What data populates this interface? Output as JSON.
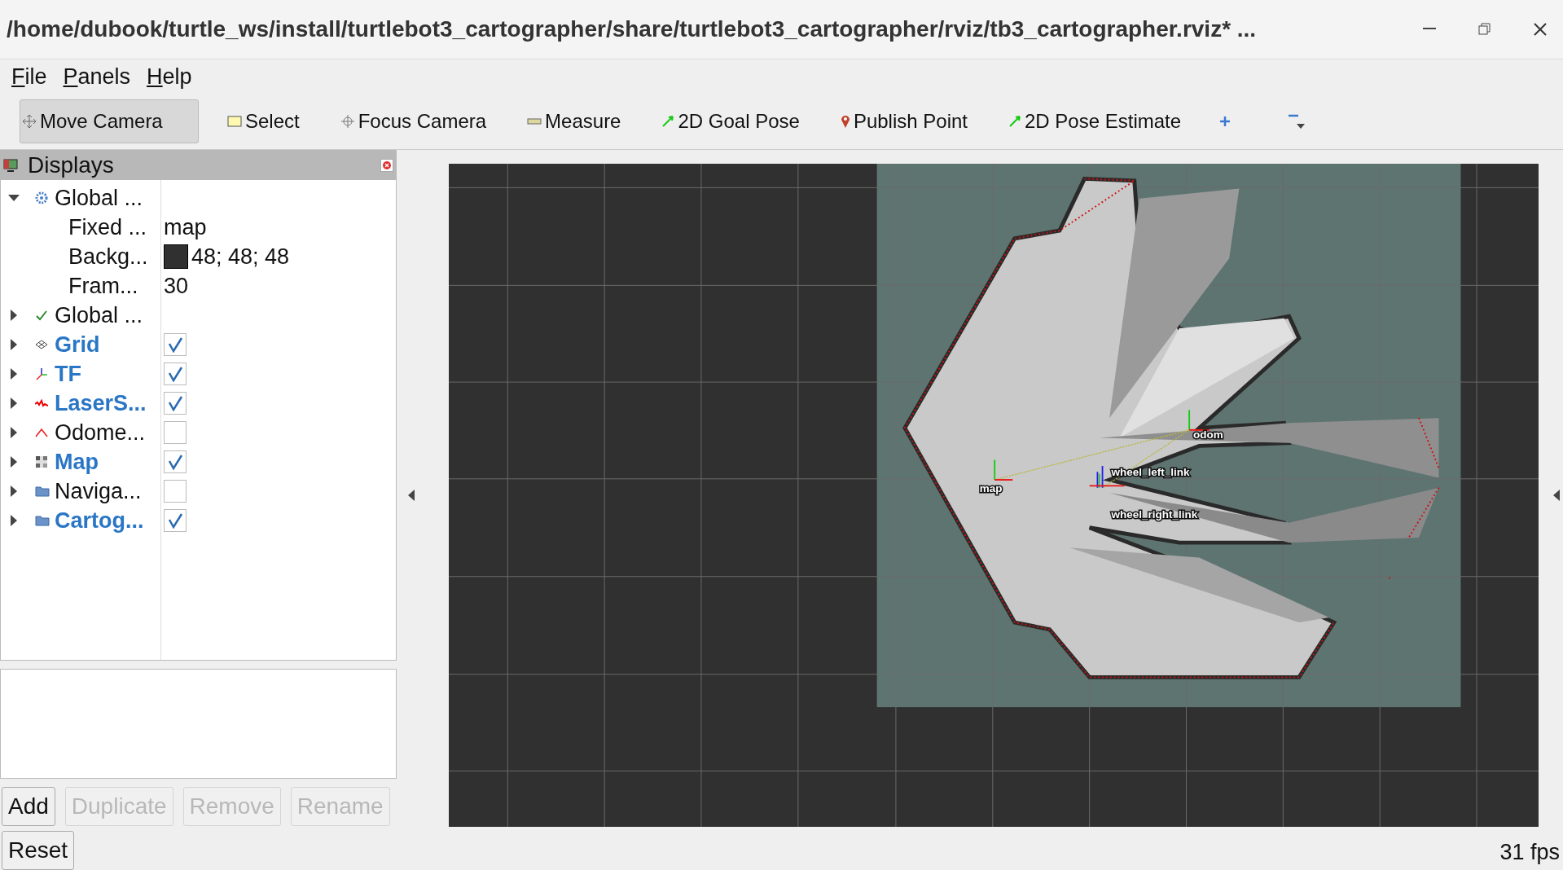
{
  "window": {
    "title": "/home/dubook/turtle_ws/install/turtlebot3_cartographer/share/turtlebot3_cartographer/rviz/tb3_cartographer.rviz* ..."
  },
  "menu": [
    "File",
    "Panels",
    "Help"
  ],
  "tools": [
    {
      "label": "Move Camera",
      "selected": true
    },
    {
      "label": "Select",
      "selected": false
    },
    {
      "label": "Focus Camera",
      "selected": false
    },
    {
      "label": "Measure",
      "selected": false
    },
    {
      "label": "2D Goal Pose",
      "selected": false
    },
    {
      "label": "Publish Point",
      "selected": false
    },
    {
      "label": "2D Pose Estimate",
      "selected": false
    }
  ],
  "displays": {
    "title": "Displays",
    "items": [
      {
        "kind": "global",
        "name": "Global ...",
        "expanded": true,
        "children": [
          {
            "name": "Fixed ...",
            "value": "map"
          },
          {
            "name": "Backg...",
            "value": "48; 48; 48",
            "color": "#303030"
          },
          {
            "name": "Fram...",
            "value": "30"
          }
        ]
      },
      {
        "kind": "global",
        "name": "Global ...",
        "expanded": false
      },
      {
        "kind": "display",
        "name": "Grid",
        "expanded": false,
        "checked": true
      },
      {
        "kind": "display",
        "name": "TF",
        "expanded": false,
        "checked": true
      },
      {
        "kind": "display",
        "name": "LaserS...",
        "expanded": false,
        "checked": true
      },
      {
        "kind": "display",
        "name": "Odome...",
        "expanded": false,
        "checked": false
      },
      {
        "kind": "display",
        "name": "Map",
        "expanded": false,
        "checked": true
      },
      {
        "kind": "display",
        "name": "Naviga...",
        "expanded": false,
        "checked": false
      },
      {
        "kind": "display",
        "name": "Cartog...",
        "expanded": false,
        "checked": true
      }
    ]
  },
  "buttons": [
    {
      "label": "Add",
      "disabled": false
    },
    {
      "label": "Duplicate",
      "disabled": true
    },
    {
      "label": "Remove",
      "disabled": true
    },
    {
      "label": "Rename",
      "disabled": true
    }
  ],
  "reset_button": "Reset",
  "viewport": {
    "frames": [
      "map",
      "odom",
      "wheel_left_link",
      "wheel_right_link"
    ]
  },
  "fps": "31 fps"
}
